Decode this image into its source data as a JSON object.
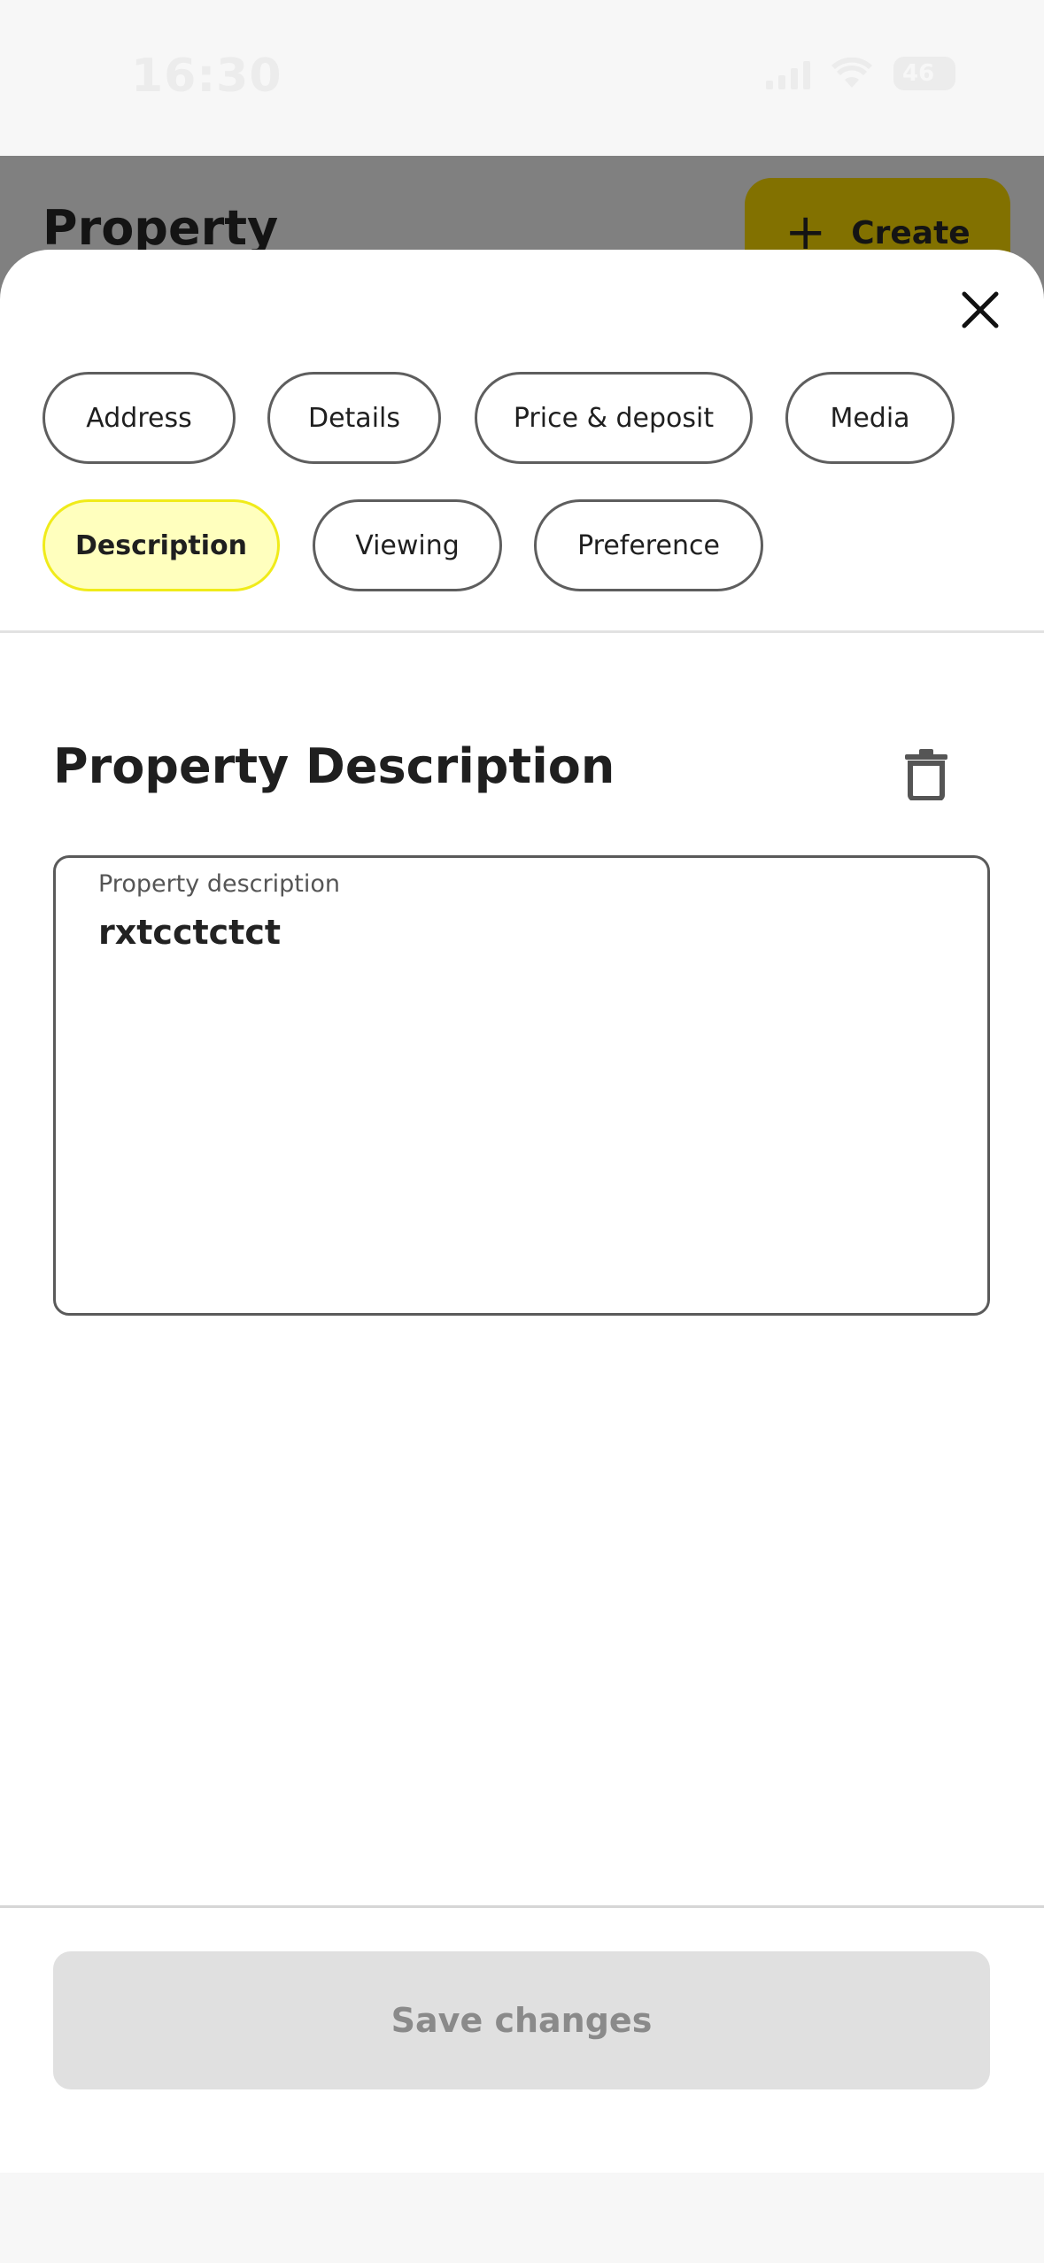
{
  "status_bar": {
    "time": "16:30",
    "battery": "46"
  },
  "background_page": {
    "title": "Property",
    "create_label": "Create"
  },
  "tabs": [
    {
      "label": "Address",
      "active": false
    },
    {
      "label": "Details",
      "active": false
    },
    {
      "label": "Price & deposit",
      "active": false
    },
    {
      "label": "Media",
      "active": false
    },
    {
      "label": "Description",
      "active": true
    },
    {
      "label": "Viewing",
      "active": false
    },
    {
      "label": "Preference",
      "active": false
    }
  ],
  "section": {
    "title": "Property Description"
  },
  "description_field": {
    "label": "Property description",
    "value": "rxtcctctct"
  },
  "actions": {
    "save_label": "Save changes"
  },
  "icons": {
    "close": "close-icon",
    "delete": "trash-icon",
    "plus": "plus-icon"
  },
  "colors": {
    "active_chip_bg": "#ffffbe",
    "active_chip_border": "#f0eb1a",
    "create_button": "#827100"
  }
}
